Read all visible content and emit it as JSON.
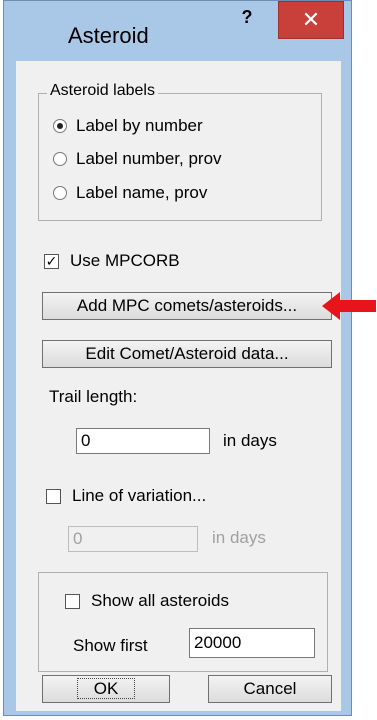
{
  "window": {
    "title": "Asteroid",
    "help_glyph": "?",
    "close_glyph": "✕"
  },
  "labels_group": {
    "legend": "Asteroid labels",
    "options": [
      "Label by number",
      "Label number, prov",
      "Label name, prov"
    ],
    "selected_index": 0
  },
  "use_mpcorb": {
    "label": "Use MPCORB",
    "checked": true
  },
  "buttons": {
    "add_mpc": "Add MPC comets/asteroids...",
    "edit_data": "Edit Comet/Asteroid data...",
    "ok": "OK",
    "cancel": "Cancel"
  },
  "trail": {
    "label": "Trail length:",
    "value": "0",
    "unit": "in days"
  },
  "line_of_variation": {
    "label": "Line of variation...",
    "checked": false,
    "value": "0",
    "unit": "in days"
  },
  "show_all": {
    "label": "Show all asteroids",
    "checked": false
  },
  "show_first": {
    "label": "Show first",
    "value": "20000"
  },
  "annotation": {
    "arrow_color": "#e8141b",
    "icon": "red-arrow-icon"
  }
}
